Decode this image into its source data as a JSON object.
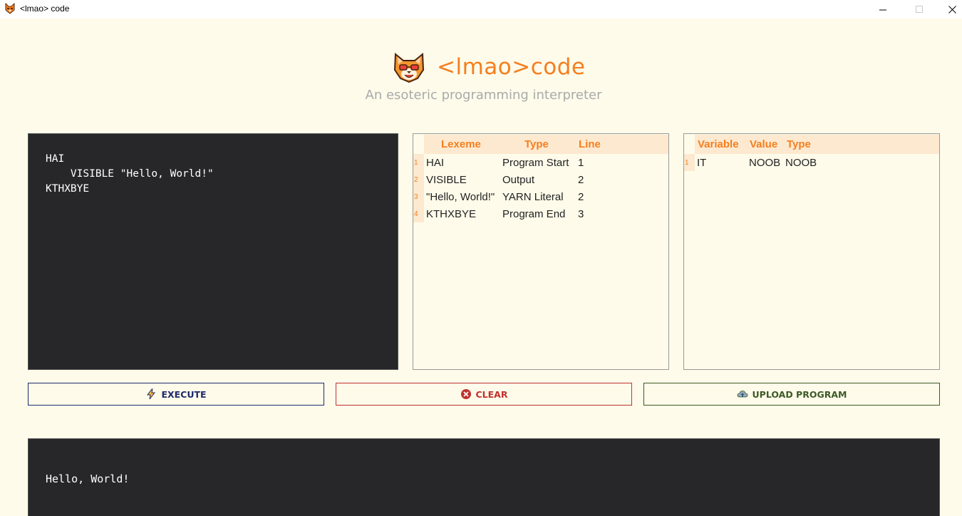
{
  "window": {
    "title": "<lmao> code",
    "minimize_glyph": "—",
    "maximize_glyph": "☐",
    "close_glyph": "✕"
  },
  "header": {
    "app_name": "<lmao>code",
    "tagline": "An esoteric programming interpreter"
  },
  "editor": {
    "code": "HAI\n    VISIBLE \"Hello, World!\"\nKTHXBYE"
  },
  "lexeme_table": {
    "columns": [
      "Lexeme",
      "Type",
      "Line"
    ],
    "rows": [
      {
        "num": "1",
        "lexeme": "HAI",
        "type": "Program Start",
        "line": "1"
      },
      {
        "num": "2",
        "lexeme": "VISIBLE",
        "type": "Output",
        "line": "2"
      },
      {
        "num": "3",
        "lexeme": "\"Hello, World!\"",
        "type": "YARN Literal",
        "line": "2"
      },
      {
        "num": "4",
        "lexeme": "KTHXBYE",
        "type": "Program End",
        "line": "3"
      }
    ]
  },
  "symbol_table": {
    "columns": [
      "Variable",
      "Value",
      "Type"
    ],
    "rows": [
      {
        "num": "1",
        "variable": "IT",
        "value": "NOOB",
        "type": "NOOB"
      }
    ]
  },
  "buttons": {
    "execute": "EXECUTE",
    "clear": "CLEAR",
    "upload": "UPLOAD PROGRAM"
  },
  "icons": {
    "execute": "lightning-icon",
    "clear": "close-circle-icon",
    "upload": "cloud-upload-icon",
    "logo": "cat-mascot-icon"
  },
  "colors": {
    "accent": "#f47f1f",
    "background": "#fefbea",
    "editor_bg": "#27272a",
    "table_header_bg": "#fde9cf",
    "execute": "#1e2a6e",
    "clear": "#c0312f",
    "upload": "#3d5a26"
  },
  "console": {
    "output": "Hello, World!"
  }
}
